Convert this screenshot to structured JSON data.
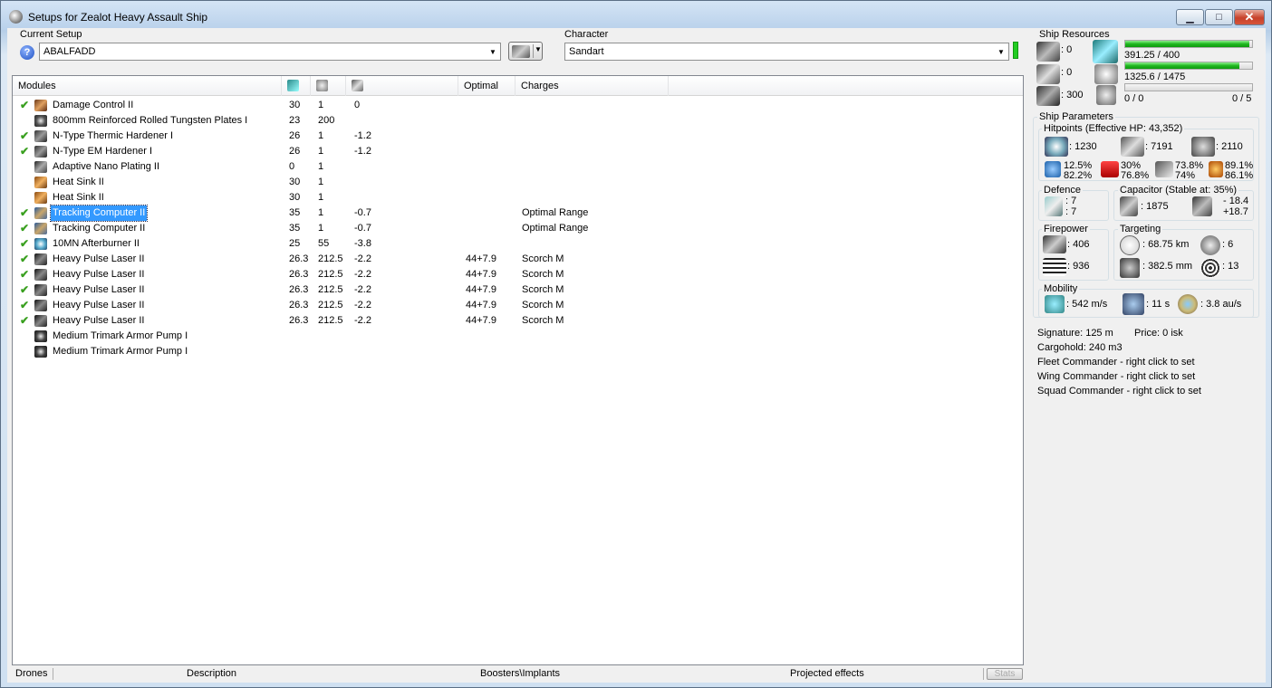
{
  "window": {
    "title": "Setups for Zealot Heavy Assault Ship",
    "minimize": "▁",
    "maximize": "□",
    "close": "✕"
  },
  "setup": {
    "label": "Current Setup",
    "value": "ABALFADD",
    "help": "?"
  },
  "character": {
    "label": "Character",
    "value": "Sandart"
  },
  "modules": {
    "columns": [
      "Modules",
      "",
      "",
      "",
      "Optimal",
      "Charges"
    ],
    "rows": [
      {
        "checked": true,
        "name": "Damage Control II",
        "cpu": "30",
        "pg": "1",
        "cap": "0",
        "optimal": "",
        "charge": "",
        "icon": "damage-control-icon"
      },
      {
        "checked": false,
        "name": "800mm Reinforced Rolled Tungsten Plates I",
        "cpu": "23",
        "pg": "200",
        "cap": "",
        "optimal": "",
        "charge": "",
        "icon": "armor-plate-icon"
      },
      {
        "checked": true,
        "name": "N-Type Thermic Hardener I",
        "cpu": "26",
        "pg": "1",
        "cap": "-1.2",
        "optimal": "",
        "charge": "",
        "icon": "hardener-icon"
      },
      {
        "checked": true,
        "name": "N-Type EM Hardener I",
        "cpu": "26",
        "pg": "1",
        "cap": "-1.2",
        "optimal": "",
        "charge": "",
        "icon": "hardener-icon"
      },
      {
        "checked": false,
        "name": "Adaptive Nano Plating II",
        "cpu": "0",
        "pg": "1",
        "cap": "",
        "optimal": "",
        "charge": "",
        "icon": "plating-icon"
      },
      {
        "checked": false,
        "name": "Heat Sink II",
        "cpu": "30",
        "pg": "1",
        "cap": "",
        "optimal": "",
        "charge": "",
        "icon": "heat-sink-icon"
      },
      {
        "checked": false,
        "name": "Heat Sink II",
        "cpu": "30",
        "pg": "1",
        "cap": "",
        "optimal": "",
        "charge": "",
        "icon": "heat-sink-icon"
      },
      {
        "checked": true,
        "name": "Tracking Computer II",
        "cpu": "35",
        "pg": "1",
        "cap": "-0.7",
        "optimal": "",
        "charge": "Optimal Range",
        "icon": "tracking-computer-icon",
        "selected": true
      },
      {
        "checked": true,
        "name": "Tracking Computer II",
        "cpu": "35",
        "pg": "1",
        "cap": "-0.7",
        "optimal": "",
        "charge": "Optimal Range",
        "icon": "tracking-computer-icon"
      },
      {
        "checked": true,
        "name": "10MN Afterburner II",
        "cpu": "25",
        "pg": "55",
        "cap": "-3.8",
        "optimal": "",
        "charge": "",
        "icon": "afterburner-icon"
      },
      {
        "checked": true,
        "name": "Heavy Pulse Laser II",
        "cpu": "26.3",
        "pg": "212.5",
        "cap": "-2.2",
        "optimal": "44+7.9",
        "charge": "Scorch M",
        "icon": "laser-icon"
      },
      {
        "checked": true,
        "name": "Heavy Pulse Laser II",
        "cpu": "26.3",
        "pg": "212.5",
        "cap": "-2.2",
        "optimal": "44+7.9",
        "charge": "Scorch M",
        "icon": "laser-icon"
      },
      {
        "checked": true,
        "name": "Heavy Pulse Laser II",
        "cpu": "26.3",
        "pg": "212.5",
        "cap": "-2.2",
        "optimal": "44+7.9",
        "charge": "Scorch M",
        "icon": "laser-icon"
      },
      {
        "checked": true,
        "name": "Heavy Pulse Laser II",
        "cpu": "26.3",
        "pg": "212.5",
        "cap": "-2.2",
        "optimal": "44+7.9",
        "charge": "Scorch M",
        "icon": "laser-icon"
      },
      {
        "checked": true,
        "name": "Heavy Pulse Laser II",
        "cpu": "26.3",
        "pg": "212.5",
        "cap": "-2.2",
        "optimal": "44+7.9",
        "charge": "Scorch M",
        "icon": "laser-icon"
      },
      {
        "checked": false,
        "name": "Medium Trimark Armor Pump I",
        "cpu": "",
        "pg": "",
        "cap": "",
        "optimal": "",
        "charge": "",
        "icon": "rig-icon"
      },
      {
        "checked": false,
        "name": "Medium Trimark Armor Pump I",
        "cpu": "",
        "pg": "",
        "cap": "",
        "optimal": "",
        "charge": "",
        "icon": "rig-icon"
      }
    ]
  },
  "footer": {
    "drones": "Drones",
    "description": "Description",
    "boosters": "Boosters\\Implants",
    "projected": "Projected effects",
    "stats": "Stats"
  },
  "resources": {
    "title": "Ship Resources",
    "turrets": ": 0",
    "launchers": ": 0",
    "calibration": ": 300",
    "cpu_text": "391.25 / 400",
    "cpu_fraction": 0.978,
    "pg_text": "1325.6 / 1475",
    "pg_fraction": 0.899,
    "drone_text": "0 / 0",
    "drone_slots": "0 / 5",
    "drone_fraction": 0
  },
  "params": {
    "title": "Ship Parameters",
    "hp_title": "Hitpoints (Effective HP: 43,352)",
    "shield_hp": ": 1230",
    "armor_hp": ": 7191",
    "structure_hp": ": 2110",
    "res1_a": "12.5%",
    "res1_b": "82.2%",
    "res2_a": "30%",
    "res2_b": "76.8%",
    "res3_a": "73.8%",
    "res3_b": "74%",
    "res4_a": "89.1%",
    "res4_b": "86.1%",
    "defence_title": "Defence",
    "defence_a": ": 7",
    "defence_b": ": 7",
    "cap_title": "Capacitor (Stable at: 35%)",
    "cap_value": ": 1875",
    "cap_a": "- 18.4",
    "cap_b": "+18.7",
    "fire_title": "Firepower",
    "fire_a": ": 406",
    "fire_b": ": 936",
    "target_title": "Targeting",
    "target_range": ": 68.75 km",
    "target_count": ": 6",
    "target_res": ": 382.5 mm",
    "target_sensor": ": 13",
    "mob_title": "Mobility",
    "mob_speed": ": 542 m/s",
    "mob_align": ": 11 s",
    "mob_warp": ": 3.8 au/s"
  },
  "info": {
    "signature": "Signature: 125 m",
    "price": "Price: 0 isk",
    "cargo": "Cargohold: 240 m3",
    "fleet": "Fleet Commander - right click to set",
    "wing": "Wing Commander - right click to set",
    "squad": "Squad Commander - right click to set"
  },
  "colors": {
    "selection": "#3399ff",
    "bar_green": "#20b820",
    "check_green": "#3aa020"
  }
}
